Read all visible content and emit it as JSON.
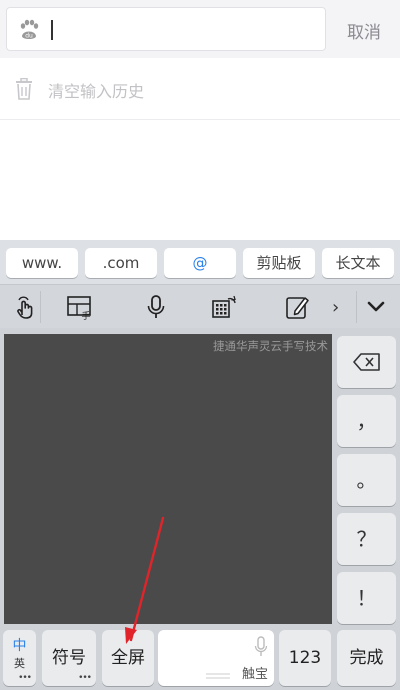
{
  "search": {
    "placeholder": "",
    "cancel_label": "取消"
  },
  "history": {
    "clear_label": "清空输入历史"
  },
  "keyboard": {
    "shortcuts": [
      {
        "label": "www."
      },
      {
        "label": ".com"
      },
      {
        "label": "@"
      },
      {
        "label": "剪贴板"
      },
      {
        "label": "长文本"
      }
    ],
    "toolbar_icons": [
      "gesture-hand-icon",
      "layout-handwriting-icon",
      "microphone-icon",
      "keypad-switch-icon",
      "edit-pen-icon",
      "chevron-right-icon",
      "collapse-keyboard-icon"
    ],
    "handwriting_watermark": "捷通华声灵云手写技术",
    "side_keys": [
      {
        "name": "backspace-key",
        "label": ""
      },
      {
        "name": "comma-key",
        "label": "，"
      },
      {
        "name": "period-key",
        "label": "。"
      },
      {
        "name": "question-key",
        "label": "？"
      },
      {
        "name": "exclaim-key",
        "label": "！"
      }
    ],
    "bottom": {
      "lang_main": "中",
      "lang_sub": "英",
      "symbols_label": "符号",
      "fullscreen_label": "全屏",
      "space_label": "触宝",
      "numbers_label": "123",
      "done_label": "完成",
      "dots": "•••"
    }
  },
  "colors": {
    "annotation_arrow": "#e0242a",
    "lang_accent": "#2c82e8",
    "at_accent": "#2c82e8"
  }
}
